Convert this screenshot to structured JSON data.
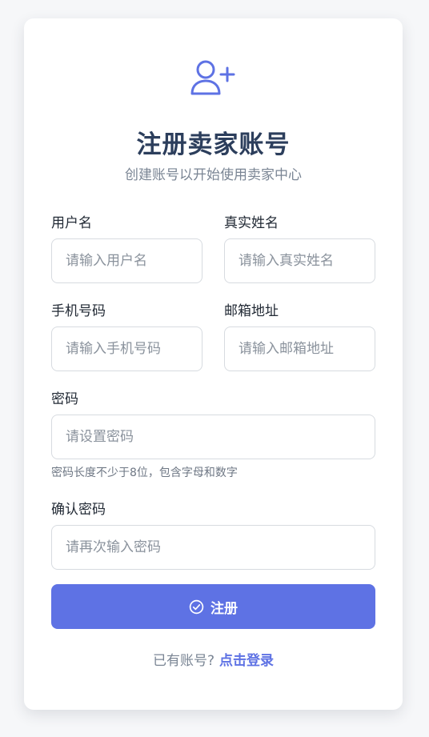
{
  "header": {
    "icon": "user-plus-icon",
    "title": "注册卖家账号",
    "subtitle": "创建账号以开始使用卖家中心"
  },
  "form": {
    "username": {
      "label": "用户名",
      "placeholder": "请输入用户名"
    },
    "realname": {
      "label": "真实姓名",
      "placeholder": "请输入真实姓名"
    },
    "phone": {
      "label": "手机号码",
      "placeholder": "请输入手机号码"
    },
    "email": {
      "label": "邮箱地址",
      "placeholder": "请输入邮箱地址"
    },
    "password": {
      "label": "密码",
      "placeholder": "请设置密码",
      "hint": "密码长度不少于8位，包含字母和数字"
    },
    "confirm": {
      "label": "确认密码",
      "placeholder": "请再次输入密码"
    },
    "submit": {
      "icon": "check-circle-icon",
      "label": "注册"
    }
  },
  "footer": {
    "text": "已有账号?",
    "link": "点击登录"
  },
  "colors": {
    "accent": "#5e72e4",
    "title": "#2c3e5c",
    "background": "#f6f7f9"
  }
}
